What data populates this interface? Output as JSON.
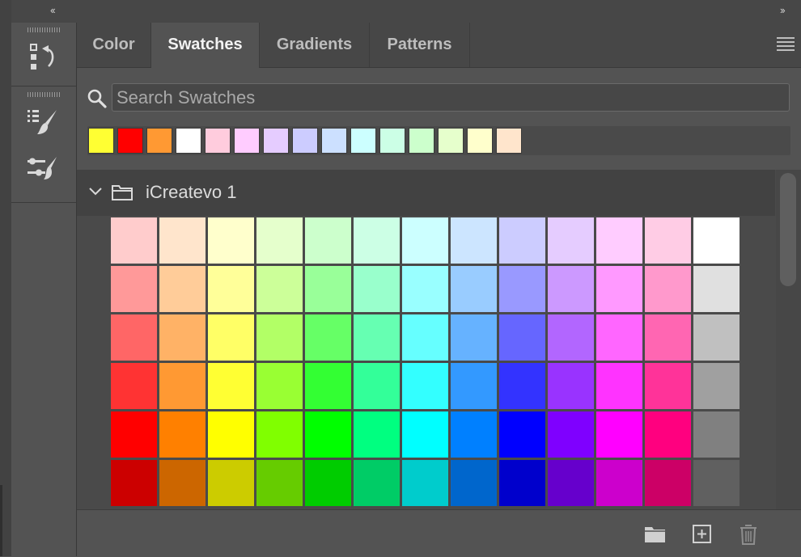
{
  "dock": {
    "collapse_left_label": "‹‹",
    "collapse_right_label": "››"
  },
  "tools": [
    {
      "name": "history-tool",
      "icon": "history-icon"
    },
    {
      "name": "brush-settings-tool",
      "icon": "brush-list-icon"
    },
    {
      "name": "adjustments-tool",
      "icon": "brush-sliders-icon"
    }
  ],
  "tabs": [
    {
      "label": "Color",
      "active": false
    },
    {
      "label": "Swatches",
      "active": true
    },
    {
      "label": "Gradients",
      "active": false
    },
    {
      "label": "Patterns",
      "active": false
    }
  ],
  "search": {
    "placeholder": "Search Swatches",
    "value": ""
  },
  "recent_swatches": [
    "#ffff33",
    "#ff0000",
    "#ff9933",
    "#ffffff",
    "#ffccdd",
    "#ffccff",
    "#e5ccff",
    "#ccccff",
    "#cce0ff",
    "#ccffff",
    "#ccffe6",
    "#ccffcc",
    "#e6ffcc",
    "#ffffcc",
    "#ffe5cc"
  ],
  "group": {
    "name": "iCreatevo 1",
    "expanded": true,
    "rows": [
      [
        "#ffcccc",
        "#ffe5cc",
        "#ffffcc",
        "#e5ffcc",
        "#ccffcc",
        "#ccffe5",
        "#ccffff",
        "#cce5ff",
        "#ccccff",
        "#e5ccff",
        "#ffccff",
        "#ffcce5",
        "#ffffff"
      ],
      [
        "#ff9999",
        "#ffcc99",
        "#ffff99",
        "#ccff99",
        "#99ff99",
        "#99ffcc",
        "#99ffff",
        "#99ccff",
        "#9999ff",
        "#cc99ff",
        "#ff99ff",
        "#ff99cc",
        "#e0e0e0"
      ],
      [
        "#ff6666",
        "#ffb266",
        "#ffff66",
        "#b2ff66",
        "#66ff66",
        "#66ffb2",
        "#66ffff",
        "#66b2ff",
        "#6666ff",
        "#b266ff",
        "#ff66ff",
        "#ff66b2",
        "#c0c0c0"
      ],
      [
        "#ff3333",
        "#ff9933",
        "#ffff33",
        "#99ff33",
        "#33ff33",
        "#33ff99",
        "#33ffff",
        "#3399ff",
        "#3333ff",
        "#9933ff",
        "#ff33ff",
        "#ff3399",
        "#a0a0a0"
      ],
      [
        "#ff0000",
        "#ff8000",
        "#ffff00",
        "#80ff00",
        "#00ff00",
        "#00ff80",
        "#00ffff",
        "#0080ff",
        "#0000ff",
        "#7f00ff",
        "#ff00ff",
        "#ff007f",
        "#808080"
      ],
      [
        "#cc0000",
        "#cc6600",
        "#cccc00",
        "#66cc00",
        "#00cc00",
        "#00cc66",
        "#00cccc",
        "#0066cc",
        "#0000cc",
        "#6600cc",
        "#cc00cc",
        "#cc0066",
        "#606060"
      ]
    ]
  },
  "bottom_actions": [
    {
      "name": "new-group-button",
      "icon": "folder-icon"
    },
    {
      "name": "new-swatch-button",
      "icon": "plus-square-icon"
    },
    {
      "name": "delete-button",
      "icon": "trash-icon"
    }
  ]
}
